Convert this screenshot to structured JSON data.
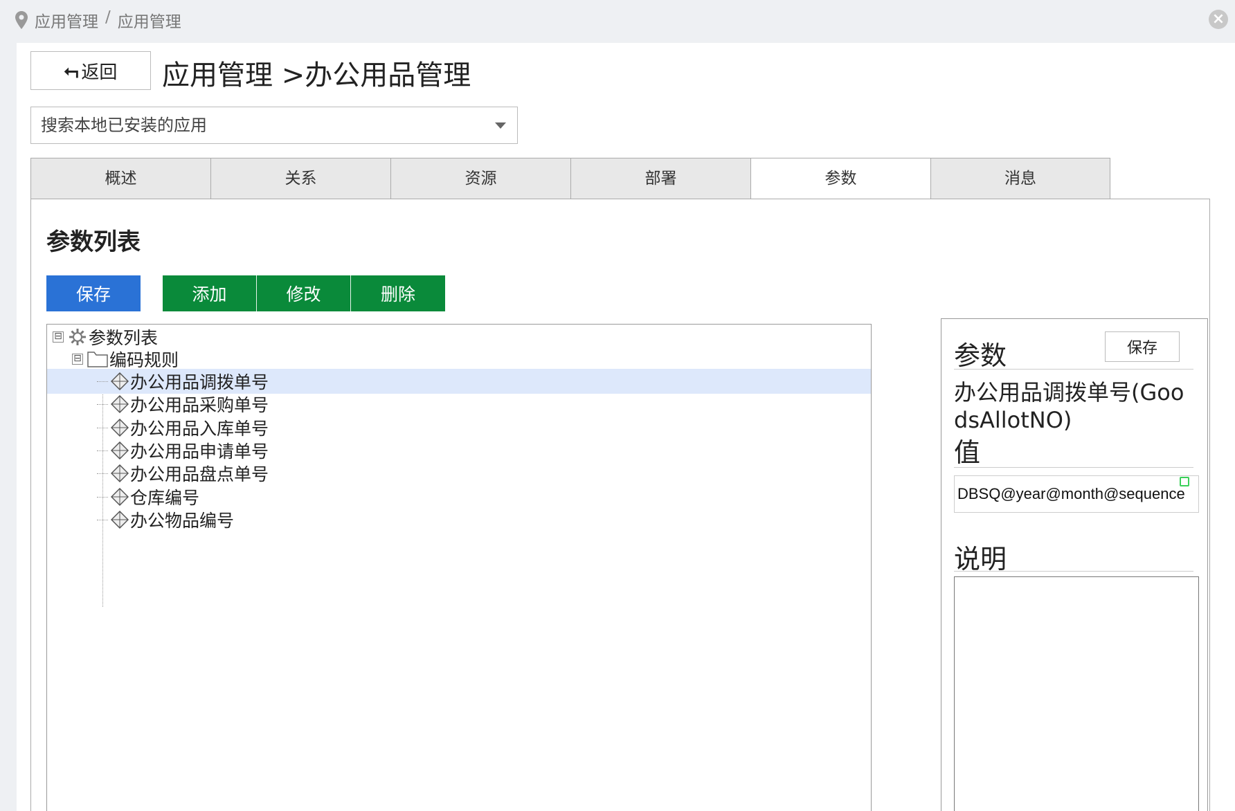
{
  "breadcrumb": [
    "应用管理",
    "应用管理"
  ],
  "breadcrumb_sep": "/",
  "close_glyph": "×",
  "back_button": {
    "arrow": "⮢",
    "label": "返回"
  },
  "page_title": "应用管理 >办公用品管理",
  "search": {
    "placeholder": "搜索本地已安装的应用"
  },
  "tabs": [
    {
      "label": "概述",
      "active": false
    },
    {
      "label": "关系",
      "active": false
    },
    {
      "label": "资源",
      "active": false
    },
    {
      "label": "部署",
      "active": false
    },
    {
      "label": "参数",
      "active": true
    },
    {
      "label": "消息",
      "active": false
    }
  ],
  "section_title": "参数列表",
  "toolbar": {
    "save": "保存",
    "add": "添加",
    "edit": "修改",
    "delete": "删除"
  },
  "tree": {
    "root": {
      "label": "参数列表",
      "toggle": "⊟",
      "icon": "gear-icon"
    },
    "folder": {
      "label": "编码规则",
      "toggle": "⊟",
      "icon": "folder-icon"
    },
    "items": [
      {
        "label": "办公用品调拨单号",
        "selected": true
      },
      {
        "label": "办公用品采购单号",
        "selected": false
      },
      {
        "label": "办公用品入库单号",
        "selected": false
      },
      {
        "label": "办公用品申请单号",
        "selected": false
      },
      {
        "label": "办公用品盘点单号",
        "selected": false
      },
      {
        "label": "仓库编号",
        "selected": false
      },
      {
        "label": "办公物品编号",
        "selected": false
      }
    ]
  },
  "side_panel": {
    "title": "参数",
    "save": "保存",
    "param_name": "办公用品调拨单号(GoodsAllotNO)",
    "value_label": "值",
    "value": "DBSQ@year@month@sequence",
    "desc_label": "说明",
    "description": ""
  },
  "colors": {
    "primary": "#2a72d6",
    "success": "#0a8a3a",
    "selected_row": "#dde8fb"
  }
}
